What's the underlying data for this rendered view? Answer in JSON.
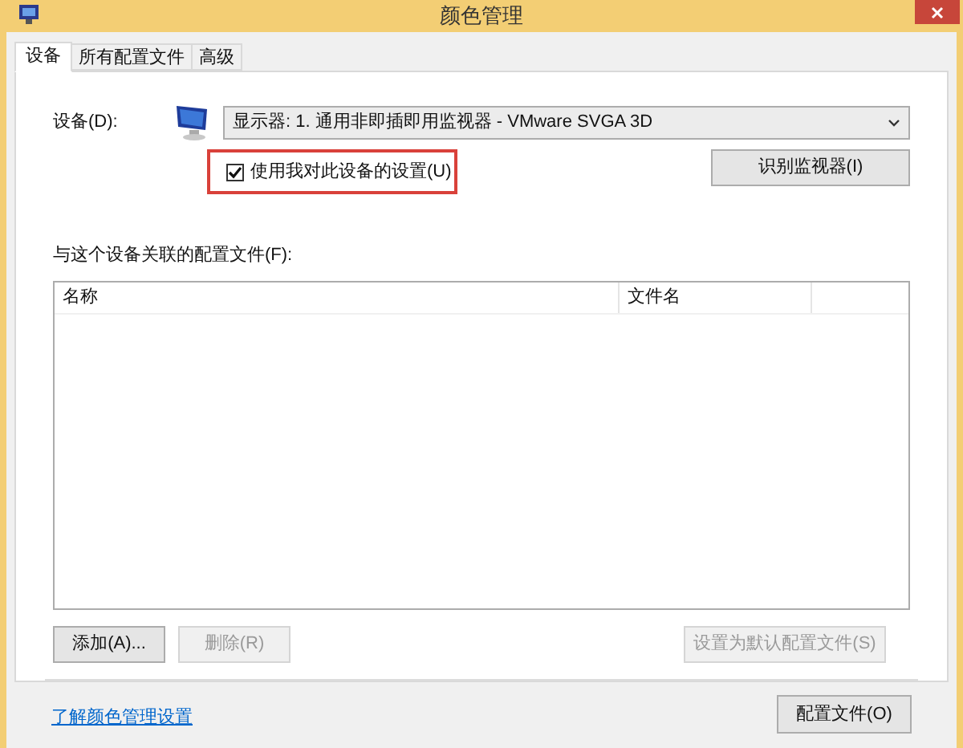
{
  "window": {
    "title": "颜色管理"
  },
  "tabs": [
    {
      "label": "设备",
      "selected": true
    },
    {
      "label": "所有配置文件",
      "selected": false
    },
    {
      "label": "高级",
      "selected": false
    }
  ],
  "device": {
    "label": "设备(D):",
    "value": "显示器: 1. 通用非即插即用监视器 - VMware SVGA 3D"
  },
  "use_my_settings": {
    "label": "使用我对此设备的设置(U)",
    "checked": true,
    "highlighted": true
  },
  "identify_button": {
    "label": "识别监视器(I)",
    "disabled": false
  },
  "profiles_label": "与这个设备关联的配置文件(F):",
  "table": {
    "columns": [
      "名称",
      "文件名"
    ]
  },
  "buttons": [
    {
      "label": "添加(A)...",
      "disabled": false
    },
    {
      "label": "删除(R)",
      "disabled": true
    },
    {
      "label": "设置为默认配置文件(S)",
      "disabled": true
    }
  ],
  "link": "了解颜色管理设置",
  "profiles_button": {
    "label": "配置文件(O)",
    "disabled": false
  }
}
